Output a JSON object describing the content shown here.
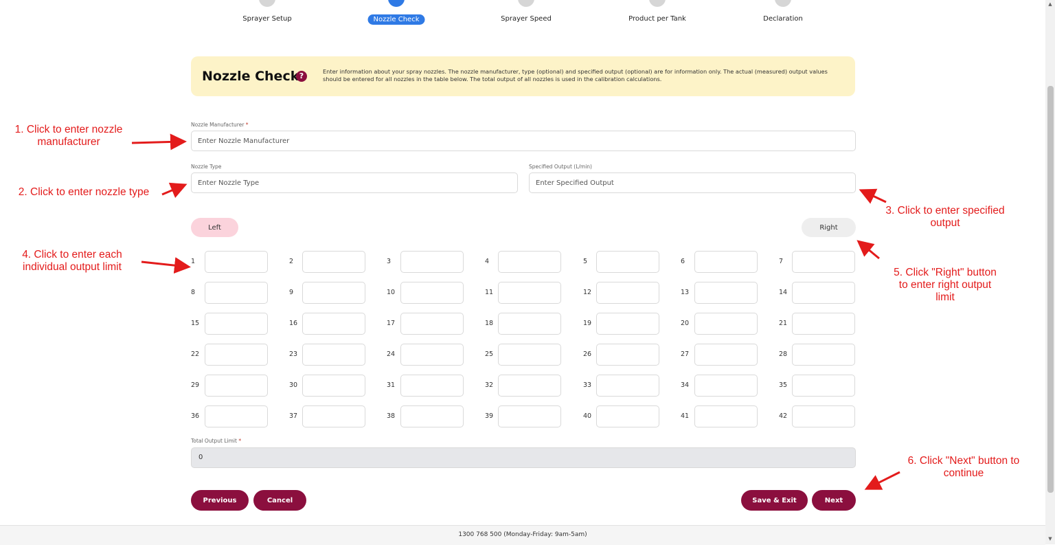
{
  "steps": [
    {
      "label": "Sprayer Setup",
      "active": false
    },
    {
      "label": "Nozzle Check",
      "active": true
    },
    {
      "label": "Sprayer Speed",
      "active": false
    },
    {
      "label": "Product per Tank",
      "active": false
    },
    {
      "label": "Declaration",
      "active": false
    }
  ],
  "banner": {
    "title": "Nozzle Check",
    "description": "Enter information about your spray nozzles. The nozzle manufacturer, type (optional) and specified output (optional) are for information only. The actual (measured) output values should be entered for all nozzles in the table below. The total output of all nozzles is used in the calibration calculations."
  },
  "form": {
    "manufacturer_label": "Nozzle Manufacturer",
    "manufacturer_placeholder": "Enter Nozzle Manufacturer",
    "type_label": "Nozzle Type",
    "type_placeholder": "Enter Nozzle Type",
    "output_label": "Specified Output (L/min)",
    "output_placeholder": "Enter Specified Output",
    "required_mark": "*",
    "left_label": "Left",
    "right_label": "Right",
    "total_label": "Total Output Limit",
    "total_value": "0"
  },
  "nozzles": [
    "1",
    "2",
    "3",
    "4",
    "5",
    "6",
    "7",
    "8",
    "9",
    "10",
    "11",
    "12",
    "13",
    "14",
    "15",
    "16",
    "17",
    "18",
    "19",
    "20",
    "21",
    "22",
    "23",
    "24",
    "25",
    "26",
    "27",
    "28",
    "29",
    "30",
    "31",
    "32",
    "33",
    "34",
    "35",
    "36",
    "37",
    "38",
    "39",
    "40",
    "41",
    "42"
  ],
  "buttons": {
    "previous": "Previous",
    "cancel": "Cancel",
    "save_exit": "Save & Exit",
    "next": "Next"
  },
  "footer": {
    "contact": "1300 768 500 (Monday-Friday: 9am-5am)"
  },
  "annotations": {
    "a1": "1. Click to enter nozzle manufacturer",
    "a2": "2. Click to enter nozzle type",
    "a3": "3. Click to enter specified output",
    "a4": "4. Click to enter each individual output limit",
    "a5": "5. Click \"Right\" button to enter right output limit",
    "a6": "6. Click \"Next\" button to continue"
  },
  "colors": {
    "accent": "#8b0f3e",
    "active_step": "#2f7ae5",
    "banner_bg": "#fdf3c8",
    "annotation": "#e31b1b",
    "left_btn": "#fbd3dc"
  }
}
